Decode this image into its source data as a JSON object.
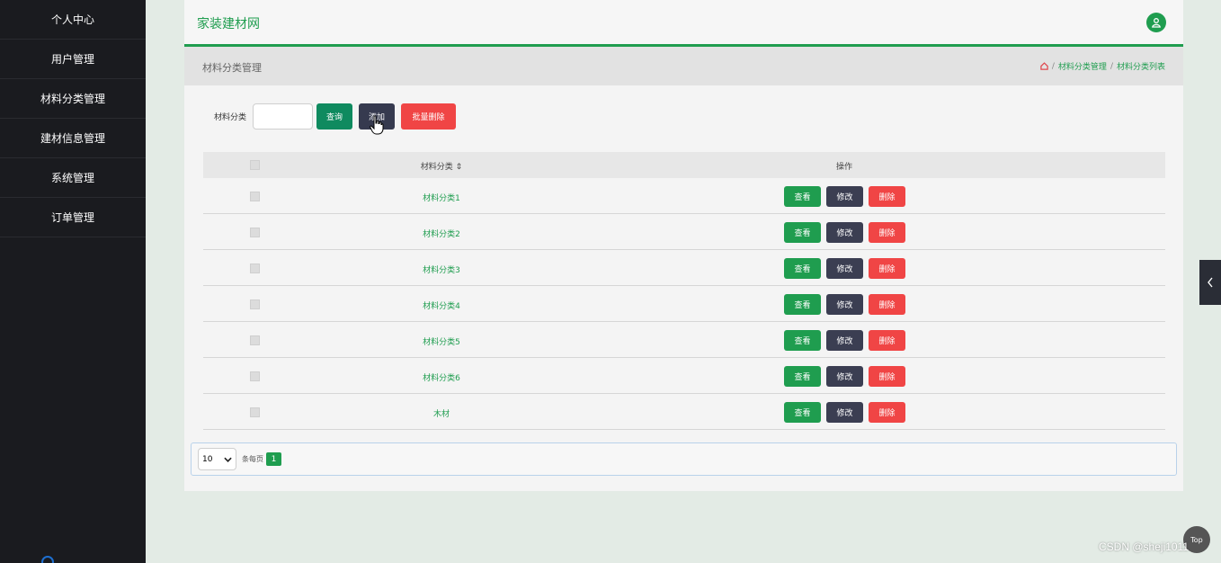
{
  "sidebar": {
    "items": [
      "个人中心",
      "用户管理",
      "材料分类管理",
      "建材信息管理",
      "系统管理",
      "订单管理"
    ]
  },
  "header": {
    "brand": "家装建材网"
  },
  "titlebar": {
    "title": "材料分类管理",
    "breadcrumb": [
      "材料分类管理",
      "材料分类列表"
    ]
  },
  "search": {
    "label": "材料分类",
    "query_label": "查询",
    "add_label": "添加",
    "batch_delete_label": "批量删除"
  },
  "table": {
    "headers": {
      "name": "材料分类 ⇕",
      "operations": "操作"
    },
    "rows": [
      "材料分类1",
      "材料分类2",
      "材料分类3",
      "材料分类4",
      "材料分类5",
      "材料分类6",
      "木材"
    ],
    "actions": {
      "view": "查看",
      "edit": "修改",
      "delete": "删除"
    }
  },
  "pagination": {
    "page_size": "10",
    "per_page_label": "条每页",
    "current_page": "1"
  },
  "top_button": "Top",
  "watermark": "CSDN @sheji1011",
  "colors": {
    "accent": "#1f9d4f",
    "danger": "#f04545",
    "dark": "#363a4f",
    "sidebar": "#1a1b1f"
  }
}
